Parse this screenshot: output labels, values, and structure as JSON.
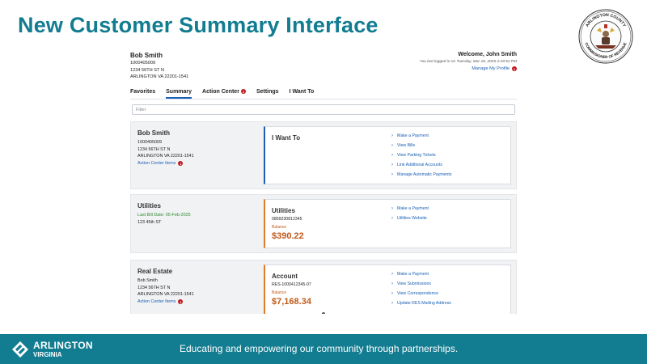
{
  "slide": {
    "title": "New Customer Summary Interface",
    "tagline": "Educating and empowering our community through partnerships."
  },
  "seal": {
    "top_text": "ARLINGTON COUNTY",
    "bottom_text": "COMMISSIONER OF REVENUE"
  },
  "logo": {
    "line1": "ARLINGTON",
    "line2": "VIRGINIA"
  },
  "header": {
    "name": "Bob Smith",
    "account": "1000405009",
    "address1": "1234 56TH ST N",
    "address2": "ARLINGTON VA 22201-1541",
    "welcome": "Welcome, John Smith",
    "last_login": "You last logged in on Tuesday, Mar 18, 2025 2:19:51 PM",
    "manage_profile": "Manage My Profile",
    "profile_badge": "1"
  },
  "tabs": [
    {
      "label": "Favorites"
    },
    {
      "label": "Summary",
      "active": true
    },
    {
      "label": "Action Center",
      "badge": "2"
    },
    {
      "label": "Settings"
    },
    {
      "label": "I Want To"
    }
  ],
  "filter": {
    "placeholder": "Filter"
  },
  "cards": {
    "customer": {
      "title": "Bob Smith",
      "account": "1000405009",
      "address1": "1234 56TH ST N",
      "address2": "ARLINGTON VA 22201-1541",
      "action_link": "Action Center Items",
      "action_badge": "1",
      "panel_title": "I Want To",
      "links": [
        "Make a Payment",
        "View Bills",
        "View Parking Tickets",
        "Link Additional Accounts",
        "Manage Automatic Payments"
      ]
    },
    "utilities": {
      "title": "Utilities",
      "last_bill": "Last Bill Date: 05-Feb-2025",
      "address": "123 45th ST",
      "panel_title": "Utilities",
      "panel_account": "0859230812345",
      "balance_label": "Balance",
      "balance": "$390.22",
      "links": [
        "Make a Payment",
        "Utilities Website"
      ]
    },
    "real_estate": {
      "title": "Real Estate",
      "owner": "Bob Smith",
      "address1": "1234 56TH ST N",
      "address2": "ARLINGTON VA 22201-1541",
      "action_link": "Action Center Items",
      "action_badge": "1",
      "panel_title": "Account",
      "panel_account": "RES-1000412345-07",
      "balance_label": "Balance",
      "balance": "$7,168.34",
      "links": [
        "Make a Payment",
        "View Submissions",
        "View Correspondence",
        "Update RES Mailing Address"
      ]
    }
  },
  "colors": {
    "teal": "#127c91",
    "link_blue": "#1a5fb4",
    "balance_orange": "#c05a1b",
    "badge_red": "#c0171a",
    "bill_green": "#2e8b2e"
  }
}
